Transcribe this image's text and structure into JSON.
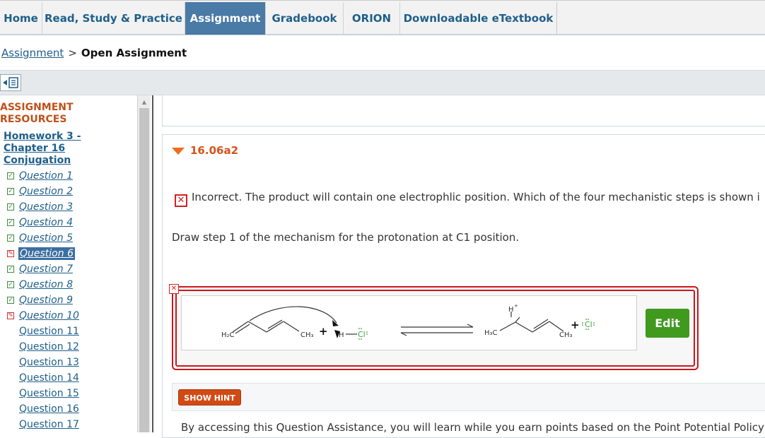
{
  "nav": {
    "tabs": [
      {
        "label": "Home"
      },
      {
        "label": "Read, Study & Practice"
      },
      {
        "label": "Assignment"
      },
      {
        "label": "Gradebook"
      },
      {
        "label": "ORION"
      },
      {
        "label": "Downloadable eTextbook"
      }
    ],
    "active": "Assignment"
  },
  "breadcrumb": {
    "link": "Assignment",
    "separator": ">",
    "current": "Open Assignment"
  },
  "toolbar": {
    "toggle_icon": "collapse-panel-icon"
  },
  "sidebar": {
    "title_line1": "ASSIGNMENT",
    "title_line2": "RESOURCES",
    "homework_line1": "Homework 3 -",
    "homework_line2": "Chapter 16",
    "homework_line3": "Conjugation",
    "questions": [
      {
        "label": "Question 1",
        "status": "complete"
      },
      {
        "label": "Question 2",
        "status": "complete"
      },
      {
        "label": "Question 3",
        "status": "complete"
      },
      {
        "label": "Question 4",
        "status": "complete"
      },
      {
        "label": "Question 5",
        "status": "complete"
      },
      {
        "label": "Question 6",
        "status": "incorrect",
        "selected": true
      },
      {
        "label": "Question 7",
        "status": "complete"
      },
      {
        "label": "Question 8",
        "status": "complete"
      },
      {
        "label": "Question 9",
        "status": "complete"
      },
      {
        "label": "Question 10",
        "status": "incorrect"
      },
      {
        "label": "Question 11",
        "status": "none"
      },
      {
        "label": "Question 12",
        "status": "none"
      },
      {
        "label": "Question 13",
        "status": "none"
      },
      {
        "label": "Question 14",
        "status": "none"
      },
      {
        "label": "Question 15",
        "status": "none"
      },
      {
        "label": "Question 16",
        "status": "none"
      },
      {
        "label": "Question 17",
        "status": "none"
      }
    ]
  },
  "question": {
    "id": "16.06a2",
    "feedback": "Incorrect. The product will contain one electrophlic position. Which of the four mechanistic steps is shown i",
    "prompt": "Draw step 1 of the mechanism for the protonation at C1 position.",
    "edit_label": "Edit",
    "hint_label": "SHOW HINT",
    "assistance_text": "By accessing this Question Assistance, you will learn while you earn points based on the Point Potential Policy",
    "drawing": {
      "reactant_left": "H₂C",
      "reactant_right": "CH₃",
      "plus1": "+",
      "acid_h": "H",
      "acid_cl": "Cl",
      "product_h": "H",
      "product_plus": "+",
      "product_left": "H₃C",
      "product_right": "CH₃",
      "plus2": "+",
      "chloride": "Cl"
    }
  },
  "colors": {
    "accent": "#4a7aa6",
    "link": "#1f5f8b",
    "error": "#c9171d",
    "edit_button": "#3f9a1e",
    "hint_button": "#d24a13",
    "orange_title": "#d4531b"
  }
}
